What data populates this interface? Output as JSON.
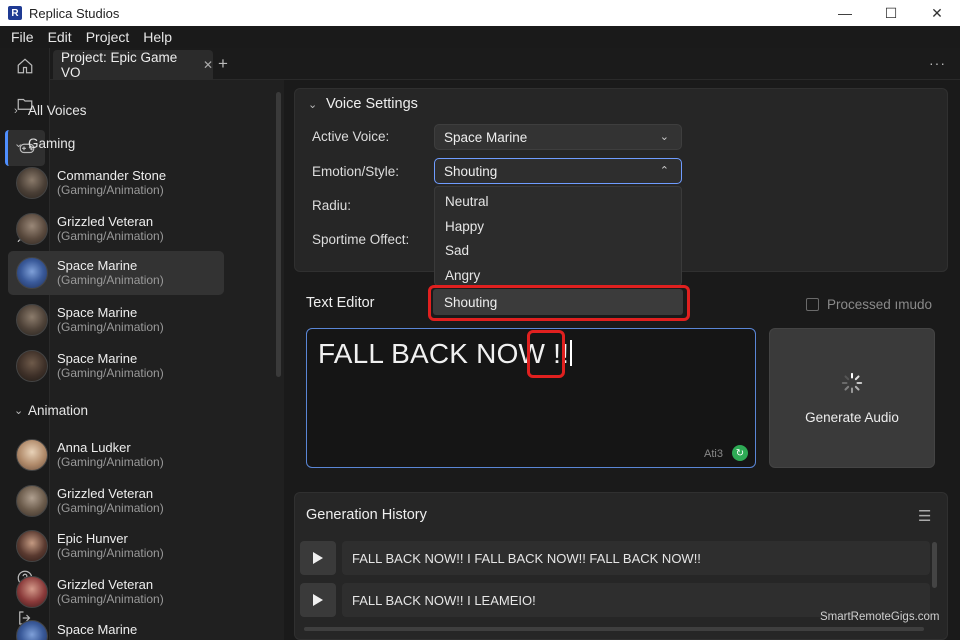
{
  "window": {
    "title": "Replica Studios",
    "logo_letter": "R",
    "controls": {
      "minimize": "—",
      "maximize": "☐",
      "close": "✕"
    }
  },
  "menu": [
    "File",
    "Edit",
    "Project",
    "Help"
  ],
  "rail_icons": [
    "home-icon",
    "folder-icon",
    "gamepad-icon",
    "microphone-icon",
    "users-icon",
    "gear-icon",
    "help-icon",
    "logout-icon"
  ],
  "tabs": {
    "active_label": "Project: Epic Game VO",
    "close_glyph": "✕",
    "add_glyph": "+",
    "more_glyph": "···"
  },
  "voices": {
    "all_voices_label": "All Voices",
    "groups": [
      {
        "label": "Gaming",
        "items": [
          {
            "name": "Commander Stone",
            "category": "(Gaming/Animation)"
          },
          {
            "name": "Grizzled Veteran",
            "category": "(Gaming/Animation)"
          },
          {
            "name": "Space Marine",
            "category": "(Gaming/Animation)",
            "selected": true
          },
          {
            "name": "Space Marine",
            "category": "(Gaming/Animation)"
          },
          {
            "name": "Space Marine",
            "category": "(Gaming/Animation)"
          }
        ]
      },
      {
        "label": "Animation",
        "items": [
          {
            "name": "Anna Ludker",
            "category": "(Gaming/Animation)"
          },
          {
            "name": "Grizzled Veteran",
            "category": "(Gaming/Animation)"
          },
          {
            "name": "Epic Hunver",
            "category": "(Gaming/Animation)"
          },
          {
            "name": "Grizzled Veteran",
            "category": "(Gaming/Animation)"
          },
          {
            "name": "Space Marine",
            "category": ""
          }
        ]
      }
    ]
  },
  "voice_settings": {
    "title": "Voice Settings",
    "active_voice_label": "Active Voice:",
    "active_voice_value": "Space Marine",
    "emotion_label": "Emotion/Style:",
    "emotion_value": "Shouting",
    "radius_label": "Radiu:",
    "offset_label": "Sportime Offect:",
    "emotion_options": [
      "Neutral",
      "Happy",
      "Sad",
      "Angry",
      "Shouting"
    ]
  },
  "text_editor": {
    "title": "Text Editor",
    "processed_label": "Processed ımudo",
    "text_main": "FALL BACK NOW ",
    "text_emphasis": "!!",
    "char_count": "Ati3",
    "generate_label": "Generate Audio"
  },
  "history": {
    "title": "Generation History",
    "menu_glyph": "☰",
    "rows": [
      "FALL BACK NOW!! I FALL BACK NOW!! FALL BACK NOW!!",
      "FALL BACK NOW!! I LEAMEIO!"
    ]
  },
  "watermark": "SmartRemoteGigs.com",
  "colors": {
    "accent": "#4f8fff",
    "highlight_red": "#e0201f",
    "refresh_green": "#2eaa55"
  }
}
